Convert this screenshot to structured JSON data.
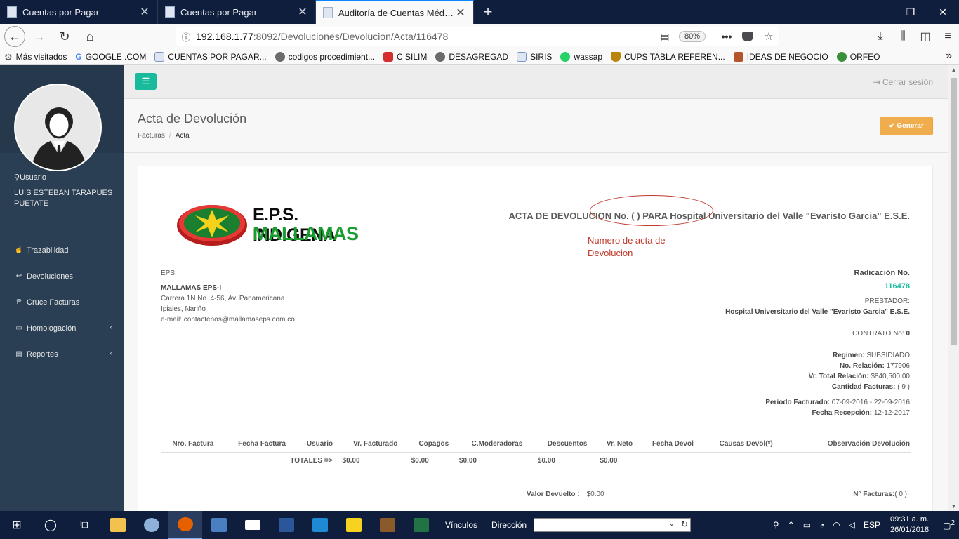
{
  "browser": {
    "tabs": [
      {
        "title": "Cuentas por Pagar",
        "active": false
      },
      {
        "title": "Cuentas por Pagar",
        "active": false
      },
      {
        "title": "Auditoría de Cuentas Médicas",
        "active": true
      }
    ],
    "url_host": "192.168.1.77",
    "url_path": ":8092/Devoluciones/Devolucion/Acta/116478",
    "zoom": "80%",
    "bookmarks": [
      {
        "label": "Más visitados",
        "color": "#555555"
      },
      {
        "label": "GOOGLE .COM",
        "color": "#4285f4"
      },
      {
        "label": "CUENTAS POR PAGAR...",
        "color": "#7a96c2"
      },
      {
        "label": "codigos procedimient...",
        "color": "#6b6b6b"
      },
      {
        "label": "C SILIM",
        "color": "#d32f2f"
      },
      {
        "label": "DESAGREGAD",
        "color": "#6b6b6b"
      },
      {
        "label": "SIRIS",
        "color": "#7a96c2"
      },
      {
        "label": "wassap",
        "color": "#25d366"
      },
      {
        "label": "CUPS TABLA REFEREN...",
        "color": "#b8860b"
      },
      {
        "label": "IDEAS DE NEGOCIO",
        "color": "#b5542a"
      },
      {
        "label": "ORFEO",
        "color": "#3a8f3a"
      }
    ]
  },
  "sidebar": {
    "user_caption": "Usuario",
    "user_name": "LUIS ESTEBAN TARAPUES PUETATE",
    "menu": [
      {
        "label": "Trazabilidad",
        "icon": "☝",
        "has_arrow": false
      },
      {
        "label": "Devoluciones",
        "icon": "↩",
        "has_arrow": false
      },
      {
        "label": "Cruce Facturas",
        "icon": "₱",
        "has_arrow": false
      },
      {
        "label": "Homologación",
        "icon": "▭",
        "has_arrow": true
      },
      {
        "label": "Reportes",
        "icon": "▤",
        "has_arrow": true
      }
    ]
  },
  "topnav": {
    "logout": "Cerrar sesión"
  },
  "page": {
    "title": "Acta de Devolución",
    "breadcrumb": [
      "Facturas",
      "Acta"
    ],
    "generate_button": "Generar"
  },
  "document": {
    "logo_line1": "E.P.S. INDIGENA",
    "logo_line2": "MALLAMAS",
    "acta_title": "ACTA DE DEVOLUCION No. (                               ) PARA Hospital Universitario del Valle \"Evaristo Garcia\" E.S.E.",
    "annotation": "Numero de acta de Devolucion",
    "eps_label": "EPS:",
    "eps_name": "MALLAMAS EPS-I",
    "eps_address": "Carrera 1N No. 4-56, Av. Panamericana",
    "eps_city": "Ipiales, Nariño",
    "eps_email": "e-mail: contactenos@mallamaseps.com.co",
    "radicacion_label": "Radicación No.",
    "radicacion_num": "116478",
    "prestador_label": "PRESTADOR:",
    "prestador_name": "Hospital Universitario del Valle \"Evaristo Garcia\" E.S.E.",
    "contrato_label": "CONTRATO No:",
    "contrato_value": "0",
    "regimen_label": "Regimen:",
    "regimen_value": "SUBSIDIADO",
    "relacion_label": "No. Relación:",
    "relacion_value": "177906",
    "total_relacion_label": "Vr. Total Relación:",
    "total_relacion_value": "$840,500.00",
    "cantidad_label": "Cantidad Facturas:",
    "cantidad_value": "( 9 )",
    "periodo_label": "Periodo Facturado:",
    "periodo_value": "07-09-2016 - 22-09-2016",
    "recepcion_label": "Fecha Recepción:",
    "recepcion_value": "12-12-2017",
    "table_headers": [
      "Nro. Factura",
      "Fecha Factura",
      "Usuario",
      "Vr. Facturado",
      "Copagos",
      "C.Moderadoras",
      "Descuentos",
      "Vr. Neto",
      "Fecha Devol",
      "Causas Devol(*)",
      "Observación Devolución"
    ],
    "totals_label": "TOTALES =>",
    "totals": {
      "facturado": "$0.00",
      "copagos": "$0.00",
      "moderadoras": "$0.00",
      "descuentos": "$0.00",
      "neto": "$0.00"
    },
    "valor_devuelto_label": "Valor Devuelto :",
    "valor_devuelto_value": "$0.00",
    "nfacturas_label": "N° Facturas:",
    "nfacturas_value": "( 0 )"
  },
  "taskbar": {
    "vinculos": "Vínculos",
    "direccion": "Dirección",
    "lang": "ESP",
    "time": "09:31 a. m.",
    "date": "26/01/2018",
    "notif_count": "2",
    "apps": [
      {
        "name": "file-explorer-icon",
        "color": "#f2c14e"
      },
      {
        "name": "paint-icon",
        "color": "#8fb0d8"
      },
      {
        "name": "firefox-icon",
        "color": "#e66000"
      },
      {
        "name": "remote-desktop-icon",
        "color": "#4a7fc1"
      },
      {
        "name": "mail-icon",
        "color": "#ffffff"
      },
      {
        "name": "word-icon",
        "color": "#2b579a"
      },
      {
        "name": "vscode-icon",
        "color": "#1f8ad2"
      },
      {
        "name": "sticky-notes-icon",
        "color": "#f7d21e"
      },
      {
        "name": "archive-icon",
        "color": "#8b5a2b"
      },
      {
        "name": "excel-icon",
        "color": "#217346"
      }
    ]
  }
}
